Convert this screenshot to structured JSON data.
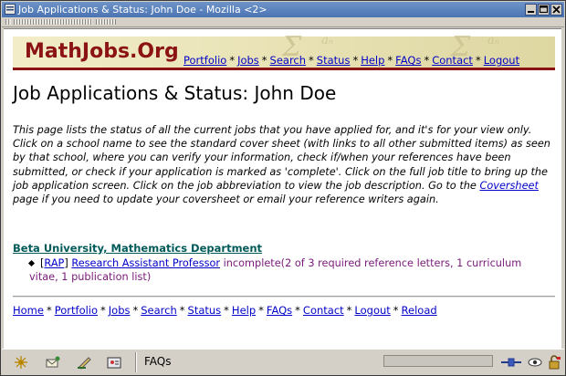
{
  "window": {
    "title": "Job Applications & Status: John Doe - Mozilla <2>"
  },
  "banner": {
    "logo": "MathJobs.Org",
    "watermark_1": "Σ",
    "watermark_2": "aₙ",
    "nav": [
      {
        "label": "Portfolio"
      },
      {
        "label": "Jobs"
      },
      {
        "label": "Search"
      },
      {
        "label": "Status"
      },
      {
        "label": "Help"
      },
      {
        "label": "FAQs"
      },
      {
        "label": "Contact"
      },
      {
        "label": "Logout"
      }
    ],
    "separator": "*"
  },
  "page": {
    "heading": "Job Applications & Status: John Doe",
    "intro_before_link": "This page lists the status of all the current jobs that you have applied for, and it's for your view only. Click on a school name to see the standard cover sheet (with links to all other submitted items) as seen by that school, where you can verify your information, check if/when your references have been submitted, or check if your application is marked as 'complete'. Click on the full job title to bring up the job application screen. Click on the job abbreviation to view the job description. Go to the ",
    "intro_link": "Coversheet",
    "intro_after_link": " page if you need to update your coversheet or email your reference writers again."
  },
  "applications": [
    {
      "school": "Beta University, Mathematics Department",
      "jobs": [
        {
          "bracket_open": "[",
          "abbrev": "RAP",
          "bracket_close": "]",
          "title": "Research Assistant Professor",
          "status": "incomplete(2 of 3 required reference letters, 1 curriculum vitae, 1 publication list)"
        }
      ]
    }
  ],
  "footer_nav": [
    {
      "label": "Home"
    },
    {
      "label": "Portfolio"
    },
    {
      "label": "Jobs"
    },
    {
      "label": "Search"
    },
    {
      "label": "Status"
    },
    {
      "label": "Help"
    },
    {
      "label": "FAQs"
    },
    {
      "label": "Contact"
    },
    {
      "label": "Logout"
    },
    {
      "label": "Reload"
    }
  ],
  "statusbar": {
    "text": "FAQs",
    "icons": [
      "navigator-icon",
      "mail-icon",
      "composer-icon",
      "address-book-icon"
    ]
  },
  "colors": {
    "titlebar": "#4a73b3",
    "logo": "#8b1313",
    "link": "#0000c8",
    "school_link": "#005a5a",
    "status_text": "#7a1a7a",
    "banner_bg": "#ded7a2"
  }
}
